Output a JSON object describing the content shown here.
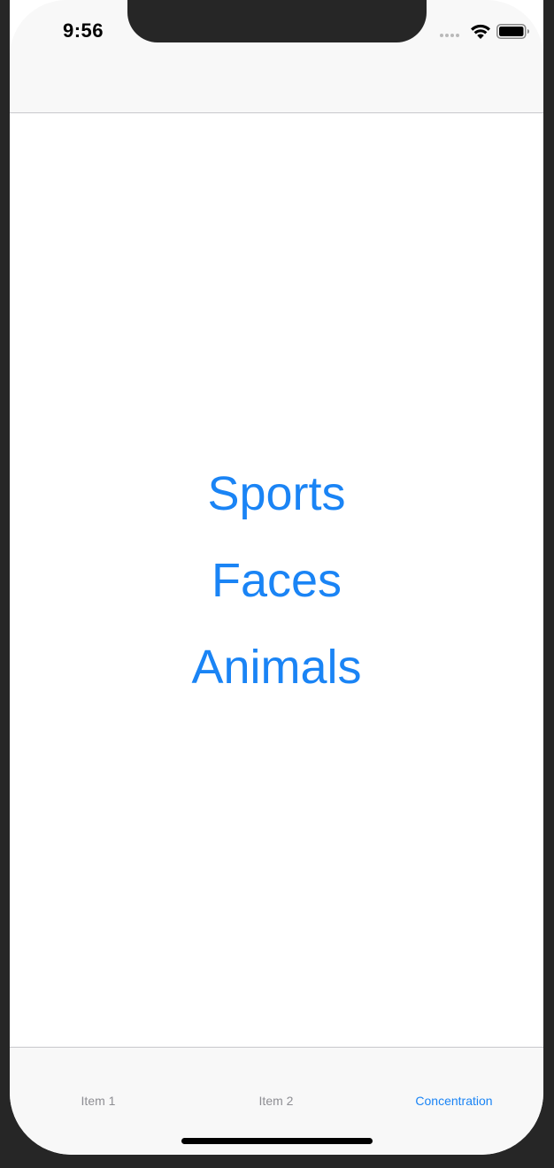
{
  "status_bar": {
    "time": "9:56",
    "icons": [
      "cellular-signal-icon",
      "wifi-icon",
      "battery-icon"
    ]
  },
  "navbar": {
    "title": ""
  },
  "main": {
    "choices": [
      {
        "label": "Sports"
      },
      {
        "label": "Faces"
      },
      {
        "label": "Animals"
      }
    ]
  },
  "tab_bar": {
    "items": [
      {
        "label": "Item 1",
        "selected": false
      },
      {
        "label": "Item 2",
        "selected": false
      },
      {
        "label": "Concentration",
        "selected": true
      }
    ]
  },
  "colors": {
    "accent": "#1a84f5",
    "inactive_tab": "#8e8e93",
    "bar_background": "#f8f8f8",
    "device_frame": "#262626"
  }
}
